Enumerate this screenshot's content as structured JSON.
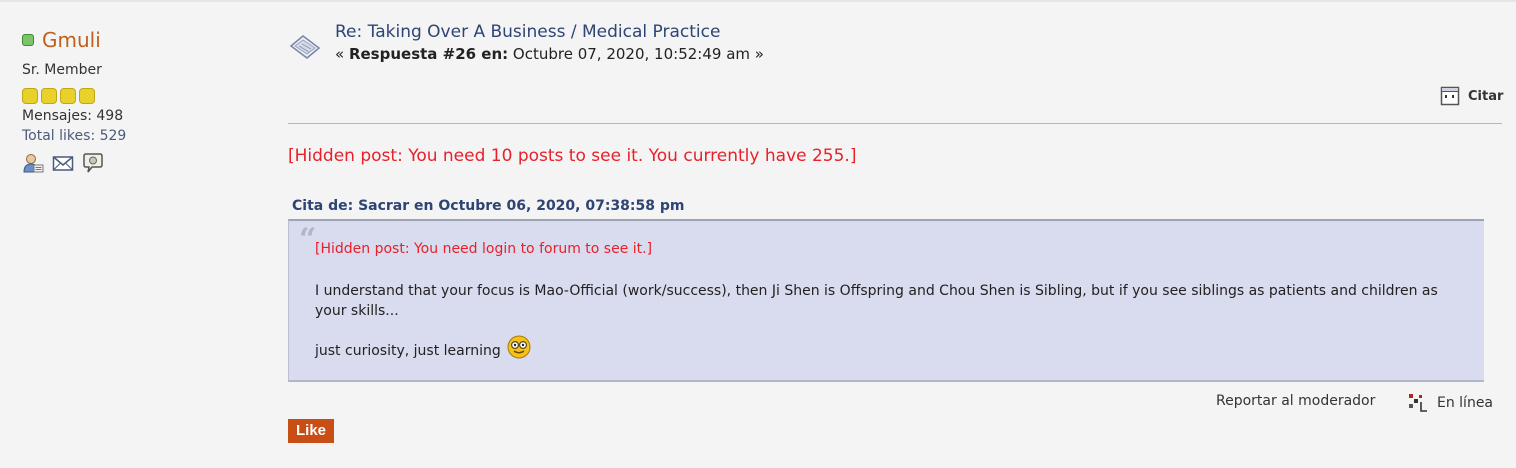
{
  "poster": {
    "name": "Gmuli",
    "group": "Sr. Member",
    "stars": 4,
    "posts": "Mensajes: 498",
    "likes": "Total likes: 529",
    "icons": [
      "profile-icon",
      "email-icon",
      "personal-message-icon"
    ]
  },
  "post": {
    "subject": "Re: Taking Over A Business / Medical Practice",
    "meta_open": "« ",
    "meta_label": "Respuesta #26 en:",
    "meta_date": " Octubre 07, 2020, 10:52:49 am »",
    "hidden_notice": "[Hidden post: You need 10 posts to see it. You currently have 255.]"
  },
  "actions": {
    "quote_label": "Citar",
    "report_label": "Reportar al moderador",
    "online_label": "En línea",
    "like_label": "Like"
  },
  "quote": {
    "header": "Cita de: Sacrar en Octubre 06, 2020, 07:38:58 pm",
    "hidden_notice": "[Hidden post: You need login to forum to see it.]",
    "body": "I understand that your focus is Mao-Official (work/success), then Ji Shen is Offspring and Chou Shen is Sibling, but if you see siblings as patients and children as your skills...",
    "closing": "just curiosity, just learning"
  },
  "colors": {
    "name": "#c0601c",
    "hidden": "#e8202a",
    "like_bg": "#c94e16",
    "quote_bg": "#d9dbee",
    "link": "#2e4474"
  }
}
